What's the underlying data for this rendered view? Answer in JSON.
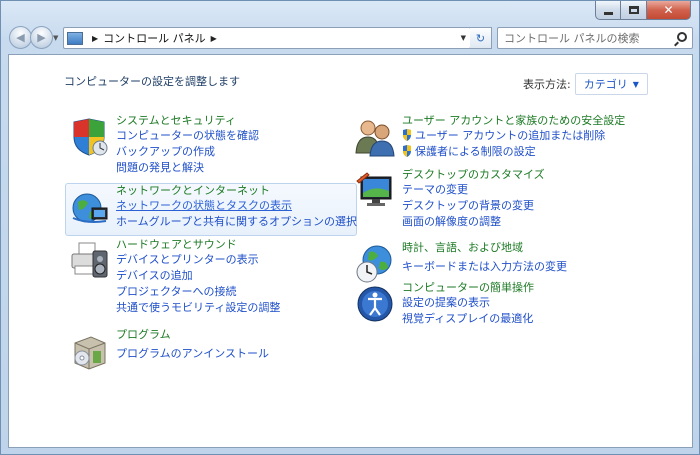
{
  "window": {
    "address_segments": [
      "コントロール パネル"
    ],
    "search_placeholder": "コントロール パネルの検索"
  },
  "header": {
    "title": "コンピューターの設定を調整します",
    "view_label": "表示方法:",
    "view_value": "カテゴリ"
  },
  "categories": [
    {
      "title": "システムとセキュリティ",
      "links": [
        "コンピューターの状態を確認",
        "バックアップの作成",
        "問題の発見と解決"
      ]
    },
    {
      "title": "ネットワークとインターネット",
      "links": [
        "ネットワークの状態とタスクの表示",
        "ホームグループと共有に関するオプションの選択"
      ]
    },
    {
      "title": "ハードウェアとサウンド",
      "links": [
        "デバイスとプリンターの表示",
        "デバイスの追加",
        "プロジェクターへの接続",
        "共通で使うモビリティ設定の調整"
      ]
    },
    {
      "title": "プログラム",
      "links": [
        "プログラムのアンインストール"
      ]
    },
    {
      "title": "ユーザー アカウントと家族のための安全設定",
      "links": [
        "ユーザー アカウントの追加または削除",
        "保護者による制限の設定"
      ]
    },
    {
      "title": "デスクトップのカスタマイズ",
      "links": [
        "テーマの変更",
        "デスクトップの背景の変更",
        "画面の解像度の調整"
      ]
    },
    {
      "title": "時計、言語、および地域",
      "links": [
        "キーボードまたは入力方法の変更"
      ]
    },
    {
      "title": "コンピューターの簡単操作",
      "links": [
        "設定の提案の表示",
        "視覚ディスプレイの最適化"
      ]
    }
  ]
}
